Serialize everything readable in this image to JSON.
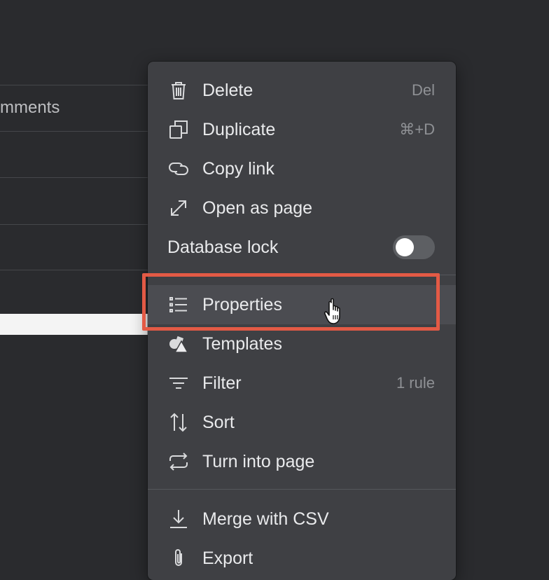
{
  "background": {
    "partial_text": "mments"
  },
  "menu": {
    "items": [
      {
        "label": "Delete",
        "shortcut": "Del",
        "icon": "trash-icon"
      },
      {
        "label": "Duplicate",
        "shortcut": "⌘+D",
        "icon": "duplicate-icon"
      },
      {
        "label": "Copy link",
        "icon": "link-icon"
      },
      {
        "label": "Open as page",
        "icon": "expand-arrows-icon"
      },
      {
        "label": "Database lock",
        "toggle_on": false
      },
      {
        "label": "Properties",
        "icon": "list-icon",
        "highlighted": true
      },
      {
        "label": "Templates",
        "icon": "shapes-icon"
      },
      {
        "label": "Filter",
        "shortcut": "1 rule",
        "icon": "filter-icon"
      },
      {
        "label": "Sort",
        "icon": "sort-arrows-icon"
      },
      {
        "label": "Turn into page",
        "icon": "convert-arrows-icon"
      },
      {
        "label": "Merge with CSV",
        "icon": "download-icon"
      },
      {
        "label": "Export",
        "icon": "paperclip-icon"
      }
    ]
  },
  "colors": {
    "background": "#2a2b2e",
    "menu": "#3f4044",
    "annotation": "#e35a45"
  }
}
